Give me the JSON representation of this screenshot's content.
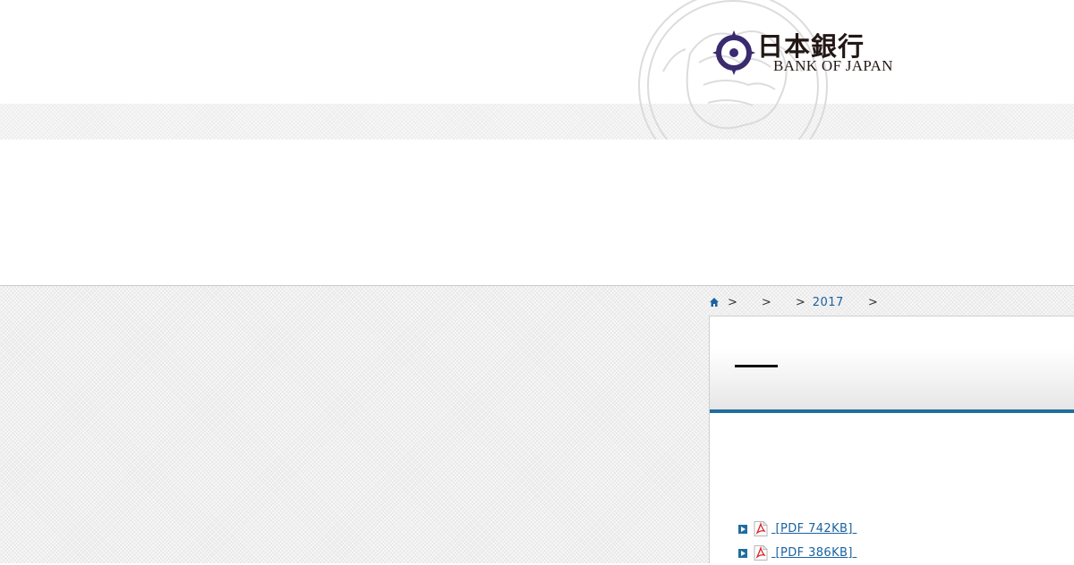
{
  "header": {
    "logo": {
      "name_jp": "日本銀行",
      "name_en": "BANK OF JAPAN",
      "brand_color": "#3a2a6e"
    }
  },
  "breadcrumb": {
    "home_icon": "home-icon",
    "separators": [
      ">",
      ">",
      ">",
      ">"
    ],
    "year_link": "2017"
  },
  "content": {
    "title": "—",
    "accent_color": "#1f6e9e",
    "downloads": [
      {
        "label": " [PDF 742KB] ",
        "icon": "pdf-icon"
      },
      {
        "label": " [PDF 386KB] ",
        "icon": "pdf-icon"
      }
    ]
  }
}
